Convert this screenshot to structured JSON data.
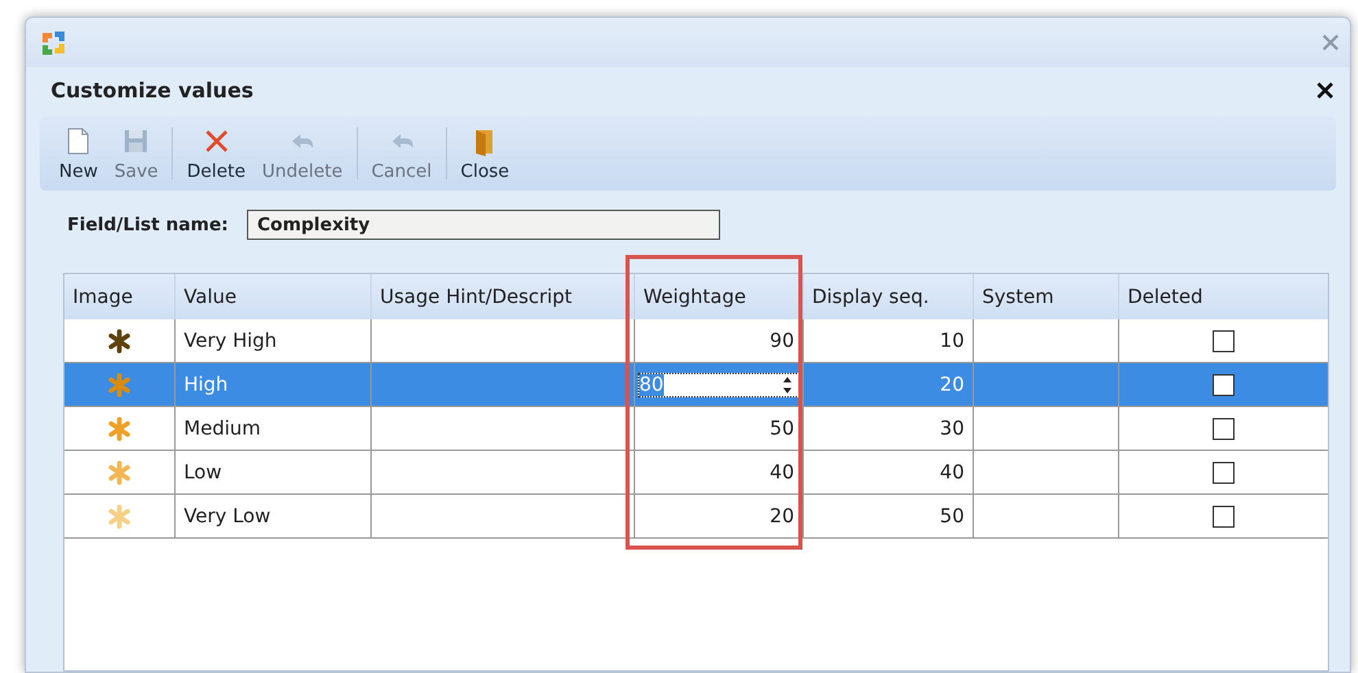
{
  "dialog": {
    "title": "Customize values"
  },
  "toolbar": [
    {
      "label": "New",
      "kind": "new",
      "disabled": false
    },
    {
      "label": "Save",
      "kind": "save",
      "disabled": true
    },
    {
      "label": "Delete",
      "kind": "delete",
      "disabled": false
    },
    {
      "label": "Undelete",
      "kind": "undelete",
      "disabled": true
    },
    {
      "label": "Cancel",
      "kind": "cancel",
      "disabled": true
    },
    {
      "label": "Close",
      "kind": "close",
      "disabled": false
    }
  ],
  "field": {
    "label": "Field/List name:",
    "value": "Complexity"
  },
  "table": {
    "columns": [
      {
        "label": "Image",
        "highlighted": false
      },
      {
        "label": "Value",
        "highlighted": false
      },
      {
        "label": "Usage Hint/Descript",
        "highlighted": false
      },
      {
        "label": "Weightage",
        "highlighted": true
      },
      {
        "label": "Display seq.",
        "highlighted": false
      },
      {
        "label": "System",
        "highlighted": false
      },
      {
        "label": "Deleted",
        "highlighted": false
      }
    ],
    "rows": [
      {
        "color": "#5e420c",
        "value": "Very High",
        "weightage": "90",
        "display_seq": "10",
        "deleted": false,
        "selected": false,
        "editing": false
      },
      {
        "color": "#d88c10",
        "value": "High",
        "weightage": "80",
        "display_seq": "20",
        "deleted": false,
        "selected": true,
        "editing": true
      },
      {
        "color": "#f0a028",
        "value": "Medium",
        "weightage": "50",
        "display_seq": "30",
        "deleted": false,
        "selected": false,
        "editing": false
      },
      {
        "color": "#f2b654",
        "value": "Low",
        "weightage": "40",
        "display_seq": "40",
        "deleted": false,
        "selected": false,
        "editing": false
      },
      {
        "color": "#f6d084",
        "value": "Very Low",
        "weightage": "20",
        "display_seq": "50",
        "deleted": false,
        "selected": false,
        "editing": false
      }
    ]
  }
}
